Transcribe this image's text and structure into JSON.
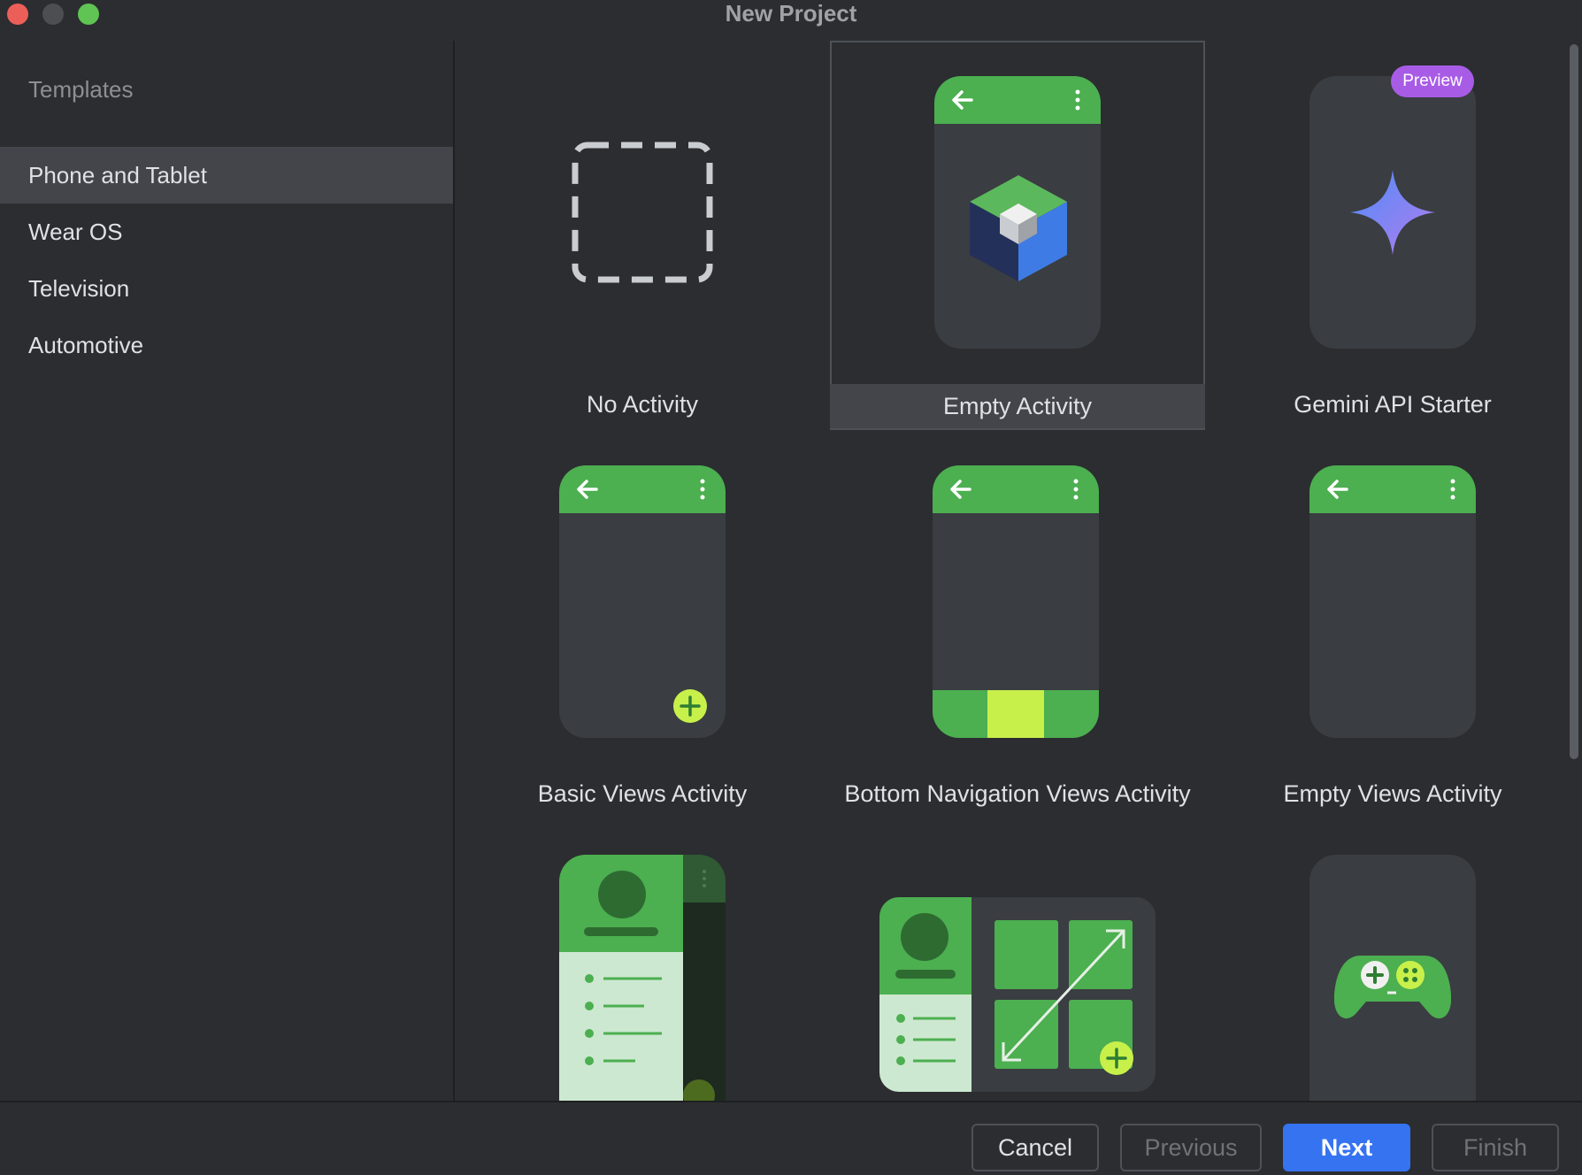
{
  "window": {
    "title": "New Project"
  },
  "sidebar": {
    "heading": "Templates",
    "items": [
      {
        "label": "Phone and Tablet",
        "selected": true
      },
      {
        "label": "Wear OS"
      },
      {
        "label": "Television"
      },
      {
        "label": "Automotive"
      }
    ]
  },
  "templates": [
    {
      "label": "No Activity",
      "icon": "dashed-square-icon"
    },
    {
      "label": "Empty Activity",
      "icon": "compose-cube-icon",
      "selected": true
    },
    {
      "label": "Gemini API Starter",
      "icon": "gemini-sparkle-icon",
      "badge": "Preview"
    },
    {
      "label": "Basic Views Activity",
      "icon": "fab-plus-icon"
    },
    {
      "label": "Bottom Navigation Views Activity",
      "icon": "bottom-nav-icon"
    },
    {
      "label": "Empty Views Activity",
      "icon": "blank-phone-icon"
    },
    {
      "label": "",
      "icon": "navigation-drawer-icon"
    },
    {
      "label": "",
      "icon": "responsive-layout-icon"
    },
    {
      "label": "",
      "icon": "game-controller-icon"
    }
  ],
  "footer": {
    "cancel": "Cancel",
    "previous": "Previous",
    "next": "Next",
    "finish": "Finish"
  },
  "colors": {
    "background": "#2b2d30",
    "selection": "#43454a",
    "accent": "#3573f0",
    "phone_bar": "#4caf50",
    "highlight": "#c8f04a",
    "badge": "#a85ce6"
  }
}
